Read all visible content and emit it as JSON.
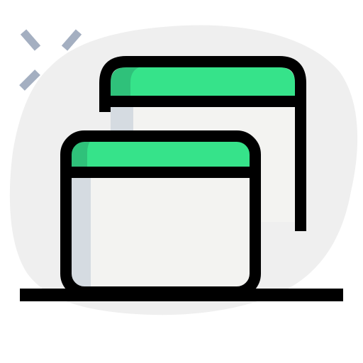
{
  "illustration": {
    "icon": "multiple-windows-icon",
    "colors": {
      "blob": "#efefef",
      "window_fill": "#f3f3f1",
      "window_shadow": "#d5dbe1",
      "titlebar": "#36e38a",
      "titlebar_shade": "#2fc17a",
      "outline": "#000000",
      "sparkle": "#a4afc1"
    }
  }
}
